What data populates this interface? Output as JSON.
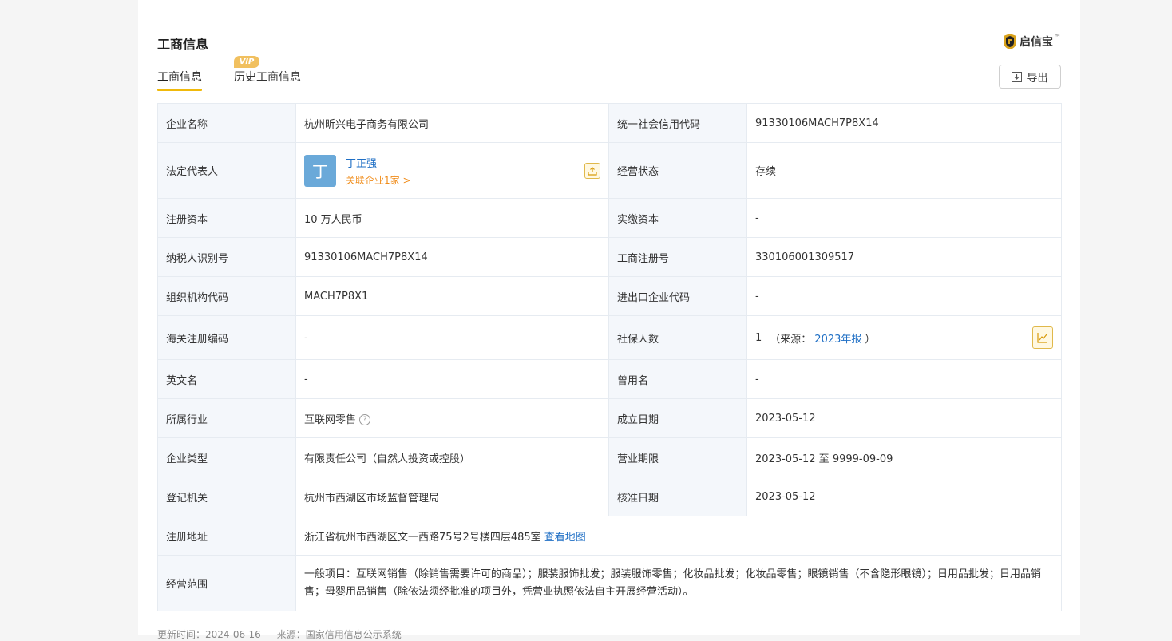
{
  "header": {
    "title": "工商信息",
    "brand": "启信宝",
    "export_label": "导出"
  },
  "tabs": [
    {
      "label": "工商信息",
      "active": true
    },
    {
      "label": "历史工商信息",
      "badge": "VIP"
    }
  ],
  "table": {
    "company_name_label": "企业名称",
    "company_name": "杭州昕兴电子商务有限公司",
    "credit_code_label": "统一社会信用代码",
    "credit_code": "91330106MACH7P8X14",
    "legal_rep_label": "法定代表人",
    "legal_rep_avatar": "丁",
    "legal_rep_name": "丁正强",
    "legal_rep_related": "关联企业1家 >",
    "status_label": "经营状态",
    "status": "存续",
    "reg_capital_label": "注册资本",
    "reg_capital": "10 万人民币",
    "paid_capital_label": "实缴资本",
    "paid_capital": "-",
    "taxpayer_id_label": "纳税人识别号",
    "taxpayer_id": "91330106MACH7P8X14",
    "reg_no_label": "工商注册号",
    "reg_no": "330106001309517",
    "org_code_label": "组织机构代码",
    "org_code": "MACH7P8X1",
    "import_export_label": "进出口企业代码",
    "import_export": "-",
    "customs_label": "海关注册编码",
    "customs": "-",
    "social_security_label": "社保人数",
    "social_security_count": "1",
    "social_security_source_prefix": "（来源：",
    "social_security_source_link": "2023年报",
    "social_security_source_suffix": "）",
    "english_name_label": "英文名",
    "english_name": "-",
    "former_name_label": "曾用名",
    "former_name": "-",
    "industry_label": "所属行业",
    "industry": "互联网零售",
    "established_label": "成立日期",
    "established": "2023-05-12",
    "company_type_label": "企业类型",
    "company_type": "有限责任公司（自然人投资或控股）",
    "business_term_label": "营业期限",
    "business_term": "2023-05-12 至 9999-09-09",
    "registration_authority_label": "登记机关",
    "registration_authority": "杭州市西湖区市场监督管理局",
    "approval_date_label": "核准日期",
    "approval_date": "2023-05-12",
    "address_label": "注册地址",
    "address": "浙江省杭州市西湖区文一西路75号2号楼四层485室",
    "map_link": "查看地图",
    "scope_label": "经营范围",
    "scope": "一般项目：互联网销售（除销售需要许可的商品）；服装服饰批发；服装服饰零售；化妆品批发；化妆品零售；眼镜销售（不含隐形眼镜）；日用品批发；日用品销售；母婴用品销售（除依法须经批准的项目外，凭营业执照依法自主开展经营活动）。"
  },
  "footer": {
    "updated": "更新时间：2024-06-16",
    "source": "来源：国家信用信息公示系统"
  }
}
